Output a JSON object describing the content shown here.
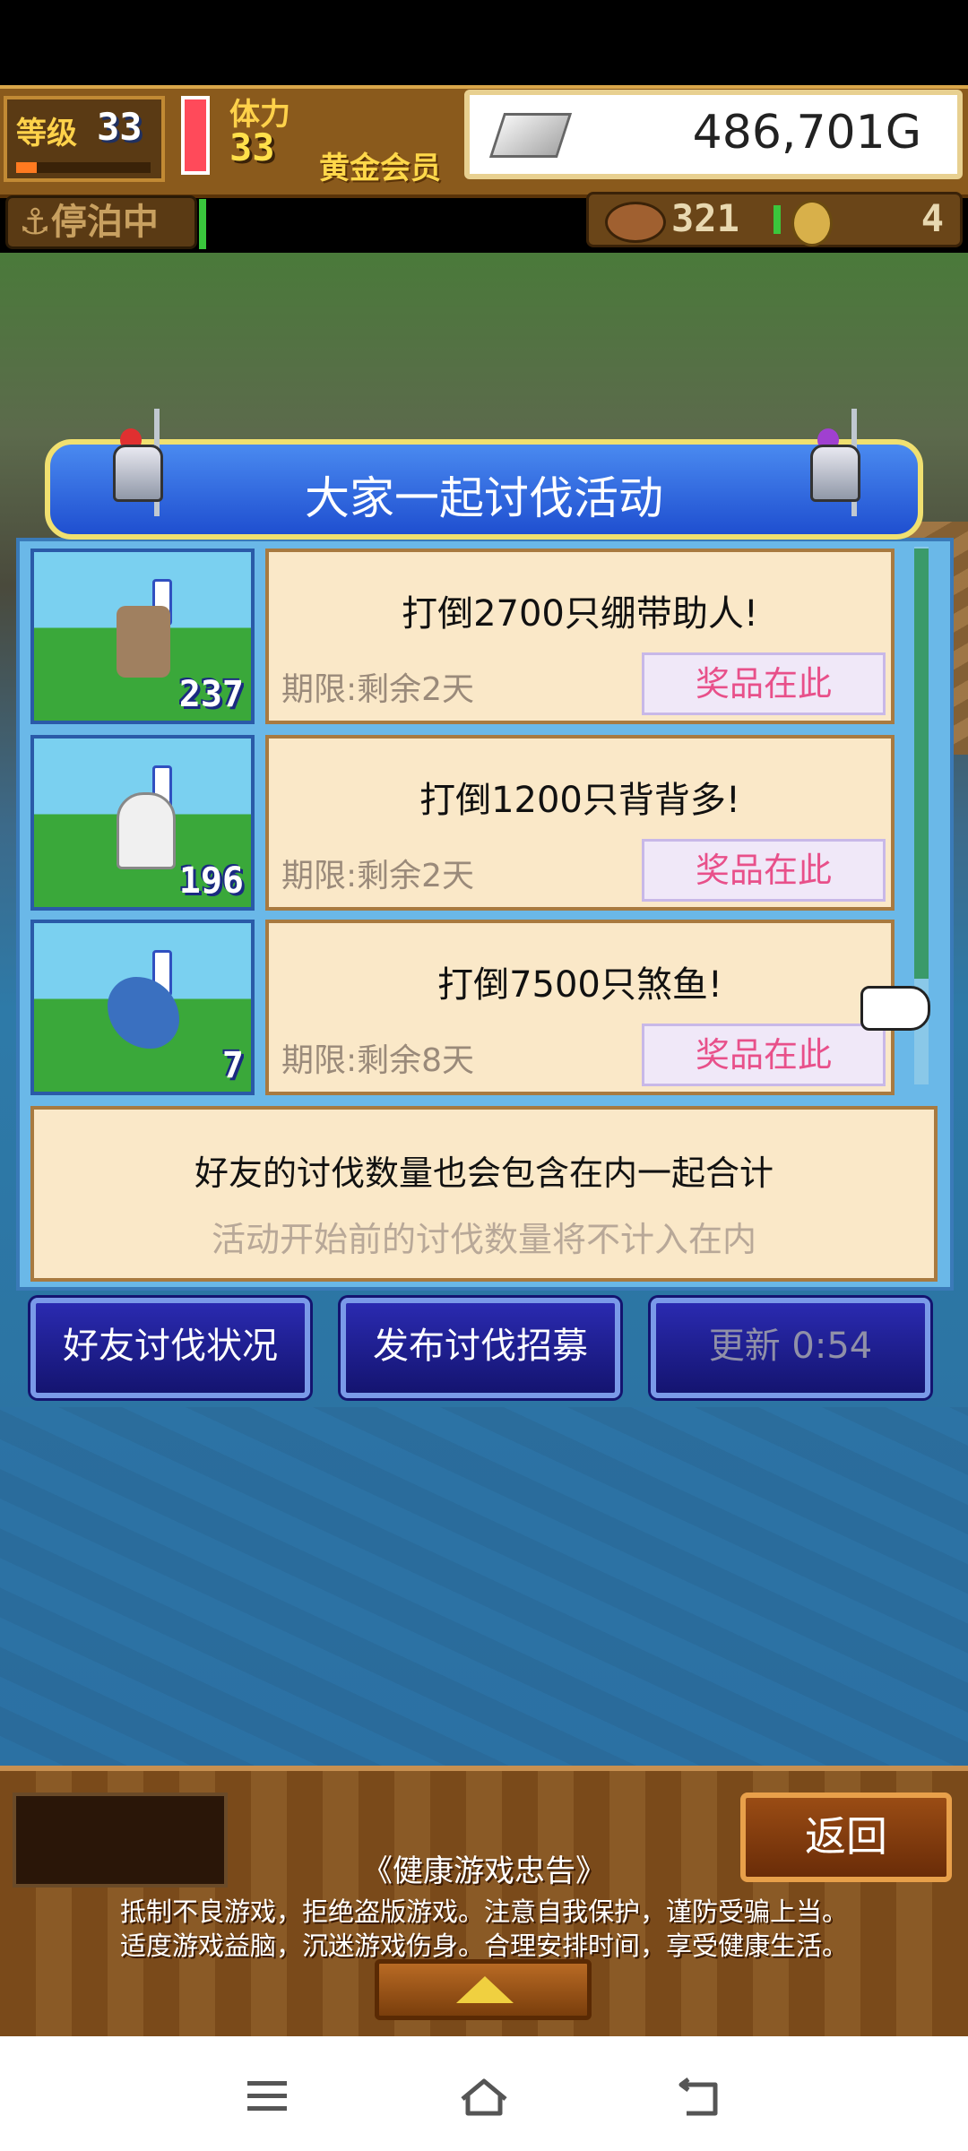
{
  "hud": {
    "level_label": "等级",
    "level_value": "33",
    "level_progress": 0.15,
    "stamina_label": "体力",
    "stamina_value": "33",
    "membership": "黄金会员",
    "money": "486,701G",
    "docked_status": "停泊中",
    "resource_value": "321",
    "count_value": "4"
  },
  "panel": {
    "title": "大家一起讨伐活动",
    "events": [
      {
        "task": "打倒2700只绷带助人!",
        "deadline": "期限:剩余2天",
        "prize": "奖品在此",
        "count": "237"
      },
      {
        "task": "打倒1200只背背多!",
        "deadline": "期限:剩余2天",
        "prize": "奖品在此",
        "count": "196"
      },
      {
        "task": "打倒7500只煞鱼!",
        "deadline": "期限:剩余8天",
        "prize": "奖品在此",
        "count": "7"
      }
    ],
    "info_main": "好友的讨伐数量也会包含在内一起合计",
    "info_sub": "活动开始前的讨伐数量将不计入在内"
  },
  "actions": {
    "friends": "好友讨伐状况",
    "recruit": "发布讨伐招募",
    "refresh": "更新 0:54"
  },
  "bottom": {
    "back": "返回",
    "health_title": "《健康游戏忠告》",
    "health_line1": "抵制不良游戏，拒绝盗版游戏。注意自我保护，谨防受骗上当。",
    "health_line2": "适度游戏益脑，沉迷游戏伤身。合理安排时间，享受健康生活。"
  },
  "colors": {
    "header_blue": "#1f4fd0",
    "card_bg": "#fae8c8",
    "prize_text": "#e8508a",
    "button_bg": "#141470"
  }
}
